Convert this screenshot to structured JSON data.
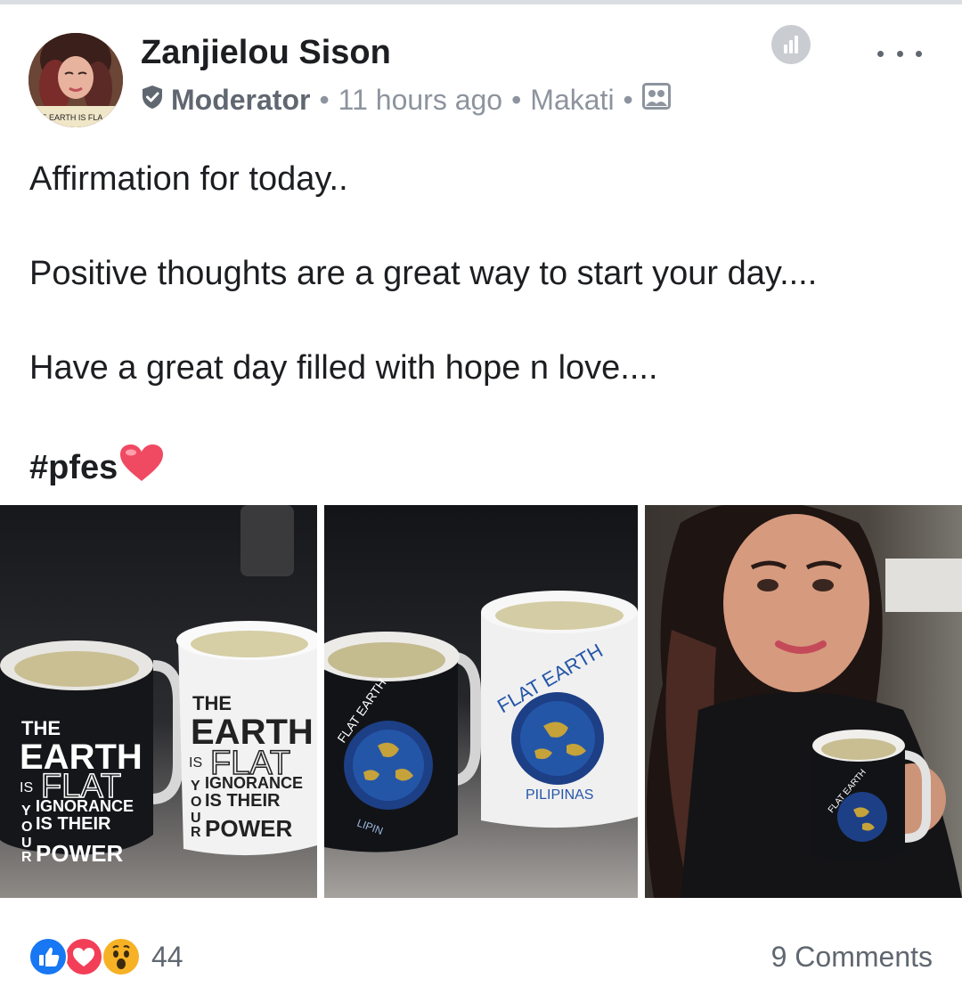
{
  "post": {
    "author": "Zanjielou Sison",
    "role": "Moderator",
    "separator": "•",
    "time": "11 hours ago",
    "location": "Makati",
    "avatar_caption": "HE EARTH IS FLA",
    "lines": [
      "Affirmation for today..",
      "Positive thoughts are a great way to start your day....",
      "Have a great day filled with hope n love...."
    ],
    "hashtag": "#pfes",
    "icons": {
      "insights": "bar-chart-icon",
      "more": "more-horizontal-icon",
      "moderator": "shield-check-icon",
      "audience": "group-photo-icon",
      "heart": "red-heart-emoji"
    }
  },
  "photos": [
    {
      "name": "photo-black-and-white-mugs",
      "mug_text": {
        "the": "THE",
        "earth": "EARTH",
        "is": "IS",
        "flat": "FLAT",
        "ignorance": "IGNORANCE",
        "is_their": "IS THEIR",
        "power": "POWER",
        "y": "Y",
        "o": "O",
        "u": "U",
        "r": "R"
      }
    },
    {
      "name": "photo-flat-earth-pilipinas-mugs",
      "mug_text": {
        "flat_earth": "FLAT EARTH",
        "pilipinas": "PILIPINAS",
        "fragment_a": "FLAT EARTH",
        "fragment_b": "LIPIN"
      }
    },
    {
      "name": "photo-woman-holding-mug",
      "mug_text": {
        "flat_earth": "FLAT EARTH"
      }
    }
  ],
  "footer": {
    "reactions": [
      "like",
      "love",
      "wow"
    ],
    "reaction_count": "44",
    "comments": "9 Comments"
  },
  "colors": {
    "like": "#1877f2",
    "love": "#f33e58",
    "wow": "#f7b125",
    "secondary_text": "#8d949e",
    "moderator_text": "#606770"
  }
}
